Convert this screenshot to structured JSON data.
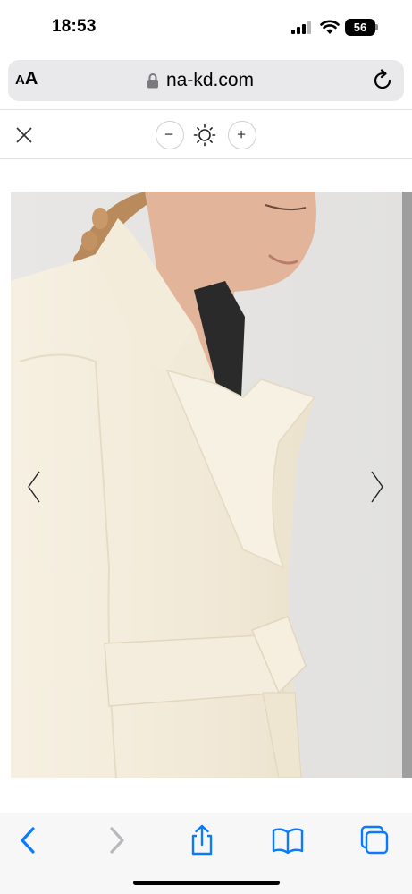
{
  "status_bar": {
    "time": "18:53",
    "battery": "56",
    "icons": [
      "signal-icon",
      "wifi-icon",
      "battery-icon"
    ]
  },
  "address_bar": {
    "text_size_label_small": "A",
    "text_size_label_large": "A",
    "url": "na-kd.com",
    "icons": [
      "lock-icon",
      "reload-icon"
    ]
  },
  "viewer_toolbar": {
    "icons": [
      "close-icon",
      "zoom-out-icon",
      "brightness-icon",
      "zoom-in-icon"
    ]
  },
  "gallery": {
    "icons": [
      "chevron-left-icon",
      "chevron-right-icon"
    ],
    "colors": {
      "background": "#e6e5e3",
      "coat": "#f4eddd",
      "skin": "#e2b49a"
    }
  },
  "bottom_toolbar": {
    "icons": [
      "back-icon",
      "forward-icon",
      "share-icon",
      "bookmarks-icon",
      "tabs-icon"
    ],
    "colors": {
      "accent": "#0a7aff",
      "disabled": "#b8b8bd"
    }
  }
}
